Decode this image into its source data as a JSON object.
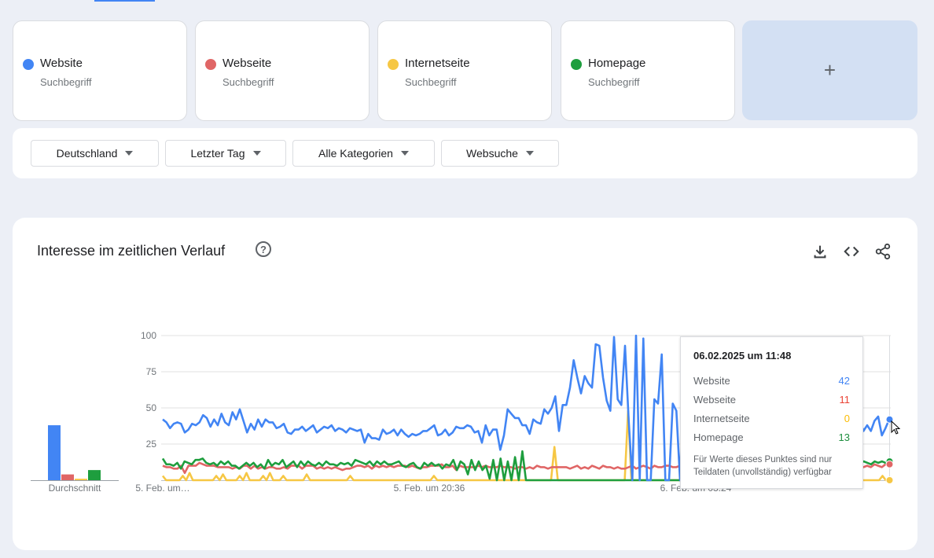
{
  "terms": [
    {
      "name": "Website",
      "type": "Suchbegriff",
      "color": "#4285f4"
    },
    {
      "name": "Webseite",
      "type": "Suchbegriff",
      "color": "#ea4335"
    },
    {
      "name": "Internetseite",
      "type": "Suchbegriff",
      "color": "#fbbc04"
    },
    {
      "name": "Homepage",
      "type": "Suchbegriff",
      "color": "#34a853"
    }
  ],
  "add_label": "+",
  "filters": {
    "region": "Deutschland",
    "time": "Letzter Tag",
    "category": "Alle Kategorien",
    "search_type": "Websuche"
  },
  "chart_panel": {
    "title": "Interesse im zeitlichen Verlauf",
    "help_glyph": "?"
  },
  "tooltip": {
    "date": "06.02.2025 um 11:48",
    "rows": [
      {
        "label": "Website",
        "value": "42",
        "color": "#4285f4"
      },
      {
        "label": "Webseite",
        "value": "11",
        "color": "#ea4335"
      },
      {
        "label": "Internetseite",
        "value": "0",
        "color": "#fbbc04"
      },
      {
        "label": "Homepage",
        "value": "13",
        "color": "#34a853"
      }
    ],
    "note": "Für Werte dieses Punktes sind nur Teildaten (unvollständig) verfügbar"
  },
  "colors": {
    "website": "#4285f4",
    "webseite": "#e06666",
    "internetseite": "#f6c744",
    "homepage": "#1e9e3e",
    "grid": "#e0e0e0"
  },
  "chart_data": [
    {
      "type": "bar",
      "title": "",
      "xlabel": "Durchschnitt",
      "ylabel": "",
      "ylim": [
        0,
        100
      ],
      "series": [
        {
          "name": "Website",
          "values": [
            38
          ]
        },
        {
          "name": "Webseite",
          "values": [
            4
          ]
        },
        {
          "name": "Internetseite",
          "values": [
            1
          ]
        },
        {
          "name": "Homepage",
          "values": [
            7
          ]
        }
      ]
    },
    {
      "type": "line",
      "title": "",
      "ylim": [
        0,
        100
      ],
      "yticks": [
        25,
        50,
        75,
        100
      ],
      "xticks": [
        "5. Feb. um…",
        "5. Feb. um 20:36",
        "6. Feb. um 03:24"
      ],
      "grid": true,
      "series": [
        {
          "name": "Website",
          "values": [
            42,
            40,
            36,
            39,
            40,
            39,
            33,
            35,
            39,
            38,
            40,
            45,
            43,
            37,
            42,
            38,
            46,
            40,
            38,
            47,
            42,
            49,
            41,
            33,
            39,
            35,
            42,
            37,
            42,
            40,
            40,
            36,
            37,
            39,
            33,
            32,
            35,
            35,
            37,
            34,
            36,
            38,
            33,
            35,
            37,
            36,
            38,
            34,
            36,
            35,
            33,
            36,
            35,
            34,
            35,
            26,
            32,
            29,
            29,
            28,
            35,
            32,
            33,
            35,
            31,
            35,
            32,
            30,
            32,
            31,
            32,
            34,
            34,
            36,
            38,
            31,
            32,
            35,
            31,
            33,
            37,
            36,
            36,
            38,
            37,
            33,
            34,
            26,
            38,
            31,
            35,
            35,
            21,
            31,
            49,
            46,
            43,
            43,
            38,
            38,
            32,
            42,
            40,
            39,
            49,
            46,
            50,
            58,
            34,
            52,
            52,
            64,
            83,
            71,
            60,
            72,
            67,
            64,
            94,
            93,
            71,
            55,
            48,
            99,
            56,
            52,
            93,
            41,
            0,
            100,
            0,
            98,
            0,
            0,
            56,
            53,
            87,
            0,
            0,
            53,
            48,
            0,
            71,
            58,
            54,
            51,
            45,
            30,
            60,
            42,
            58,
            44,
            58,
            52,
            35,
            33,
            30,
            37,
            40,
            38,
            43,
            38,
            34,
            30,
            31,
            33,
            35,
            38,
            34,
            35,
            41,
            45,
            43,
            51,
            42,
            35,
            40,
            38,
            34,
            36,
            38,
            44,
            41,
            40,
            41,
            34,
            34,
            43,
            44,
            46,
            41,
            34,
            38,
            34,
            41,
            44,
            31,
            36,
            42
          ]
        },
        {
          "name": "Webseite",
          "values": [
            10,
            9,
            9,
            8,
            8,
            10,
            5,
            10,
            10,
            10,
            12,
            11,
            10,
            10,
            10,
            9,
            9,
            9,
            9,
            8,
            9,
            8,
            10,
            10,
            8,
            10,
            8,
            9,
            8,
            9,
            9,
            8,
            8,
            9,
            8,
            10,
            10,
            10,
            8,
            10,
            10,
            10,
            8,
            9,
            8,
            9,
            8,
            9,
            8,
            7,
            8,
            8,
            9,
            10,
            10,
            9,
            10,
            8,
            10,
            9,
            10,
            9,
            10,
            9,
            10,
            10,
            10,
            9,
            10,
            9,
            8,
            9,
            9,
            10,
            10,
            10,
            11,
            9,
            9,
            10,
            7,
            10,
            9,
            9,
            9,
            9,
            10,
            9,
            10,
            9,
            9,
            9,
            10,
            9,
            9,
            9,
            8,
            9,
            9,
            8,
            9,
            8,
            10,
            9,
            9,
            8,
            9,
            9,
            9,
            9,
            9,
            8,
            9,
            10,
            8,
            9,
            8,
            10,
            9,
            8,
            10,
            9,
            9,
            8,
            9,
            8,
            8,
            9,
            10,
            8,
            9,
            10,
            9,
            8,
            10,
            9,
            9,
            10,
            10,
            9,
            9,
            10,
            9,
            10,
            10,
            8,
            9,
            10,
            10,
            9,
            8,
            10,
            9,
            8,
            9,
            9,
            8,
            10,
            9,
            10,
            10,
            10,
            9,
            9,
            9,
            10,
            8,
            8,
            10,
            10,
            8,
            8,
            10,
            9,
            8,
            9,
            9,
            10,
            8,
            8,
            10,
            9,
            10,
            9,
            8,
            8,
            10,
            9,
            10,
            8,
            9,
            9,
            10,
            9,
            11,
            10,
            9,
            11,
            11
          ]
        },
        {
          "name": "Internetseite",
          "values": [
            3,
            0,
            0,
            0,
            0,
            0,
            3,
            0,
            5,
            0,
            0,
            0,
            0,
            0,
            0,
            0,
            3,
            0,
            4,
            0,
            0,
            0,
            0,
            3,
            0,
            5,
            0,
            0,
            0,
            0,
            3,
            0,
            5,
            0,
            0,
            0,
            3,
            0,
            0,
            0,
            0,
            0,
            0,
            4,
            0,
            0,
            0,
            0,
            0,
            0,
            0,
            0,
            0,
            0,
            0,
            0,
            3,
            0,
            0,
            0,
            0,
            0,
            0,
            0,
            0,
            0,
            0,
            0,
            0,
            0,
            0,
            0,
            0,
            0,
            0,
            0,
            0,
            0,
            0,
            0,
            0,
            3,
            0,
            0,
            0,
            0,
            0,
            0,
            0,
            0,
            0,
            0,
            0,
            0,
            0,
            0,
            0,
            0,
            0,
            0,
            0,
            0,
            0,
            0,
            0,
            0,
            0,
            0,
            0,
            0,
            0,
            0,
            0,
            0,
            0,
            0,
            0,
            23,
            0,
            0,
            0,
            0,
            0,
            0,
            0,
            0,
            0,
            0,
            0,
            0,
            0,
            0,
            0,
            0,
            0,
            0,
            0,
            0,
            0,
            48,
            0,
            0,
            0,
            0,
            0,
            0,
            0,
            0,
            0,
            0,
            0,
            0,
            0,
            0,
            0,
            0,
            0,
            0,
            0,
            0,
            0,
            0,
            0,
            0,
            0,
            0,
            0,
            0,
            0,
            0,
            0,
            0,
            0,
            0,
            0,
            0,
            0,
            0,
            0,
            0,
            0,
            0,
            0,
            0,
            0,
            0,
            0,
            0,
            0,
            0,
            0,
            0,
            0,
            0,
            0,
            0,
            0,
            0,
            0,
            0,
            0,
            0,
            0,
            0,
            0,
            0,
            0,
            0,
            0,
            0,
            0,
            0,
            0,
            0,
            0,
            3,
            0,
            0
          ]
        },
        {
          "name": "Homepage",
          "values": [
            15,
            11,
            11,
            10,
            12,
            8,
            13,
            12,
            11,
            14,
            14,
            15,
            12,
            11,
            12,
            10,
            13,
            11,
            13,
            10,
            10,
            8,
            10,
            12,
            10,
            12,
            9,
            11,
            8,
            14,
            10,
            12,
            11,
            14,
            9,
            11,
            13,
            9,
            13,
            10,
            13,
            11,
            10,
            12,
            10,
            13,
            11,
            11,
            10,
            12,
            11,
            12,
            10,
            14,
            13,
            12,
            11,
            13,
            10,
            13,
            11,
            13,
            11,
            11,
            12,
            13,
            10,
            9,
            11,
            12,
            9,
            8,
            12,
            10,
            12,
            10,
            11,
            8,
            11,
            10,
            14,
            7,
            13,
            11,
            4,
            14,
            7,
            13,
            7,
            10,
            1,
            14,
            0,
            15,
            0,
            13,
            0,
            16,
            0,
            20,
            0,
            0,
            0,
            0,
            0,
            0,
            0,
            0,
            0,
            0,
            0,
            0,
            0,
            0,
            0,
            0,
            0,
            0,
            0,
            0,
            0,
            0,
            0,
            0,
            0,
            0,
            0,
            0,
            0,
            0,
            0,
            0,
            0,
            0,
            0,
            0,
            0,
            0,
            0,
            0,
            0,
            0,
            0,
            0,
            0,
            0,
            0,
            0,
            0,
            0,
            0,
            0,
            0,
            0,
            0,
            0,
            0,
            0,
            0,
            0,
            0,
            0,
            0,
            0,
            0,
            0,
            0,
            0,
            0,
            0,
            0,
            0,
            0,
            0,
            0,
            0,
            0,
            0,
            0,
            0,
            0,
            0,
            0,
            0,
            0,
            0,
            0,
            0,
            12,
            13,
            12,
            13,
            12,
            13,
            12,
            11,
            13,
            12,
            13,
            12,
            13
          ]
        }
      ]
    }
  ]
}
